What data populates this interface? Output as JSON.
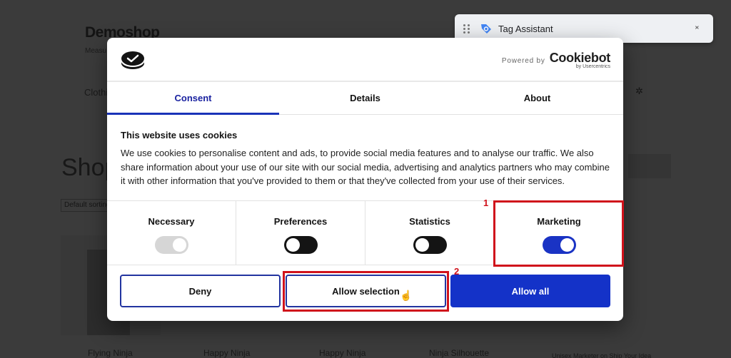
{
  "background_page": {
    "brand": "Demoshop",
    "tagline": "Measu",
    "nav_first": "Clothi",
    "page_title": "Shop",
    "sort_select": "Default sorting",
    "products": [
      "Flying Ninja",
      "Happy Ninja",
      "Happy Ninja",
      "Ninja Silhouette",
      "Unisex Marketer on Ship Your Idea"
    ]
  },
  "tag_assistant": {
    "title": "Tag Assistant",
    "brand_color": "#4285f4"
  },
  "dialog": {
    "powered_by": "Powered by",
    "provider_name": "Cookiebot",
    "provider_sub": "by Usercentrics",
    "tabs": [
      {
        "label": "Consent",
        "active": true
      },
      {
        "label": "Details",
        "active": false
      },
      {
        "label": "About",
        "active": false
      }
    ],
    "heading": "This website uses cookies",
    "body": "We use cookies to personalise content and ads, to provide social media features and to analyse our traffic. We also share information about your use of our site with our social media, advertising and analytics partners who may combine it with other information that you've provided to them or that they've collected from your use of their services.",
    "categories": [
      {
        "label": "Necessary",
        "state": "on",
        "disabled": true
      },
      {
        "label": "Preferences",
        "state": "off",
        "disabled": false
      },
      {
        "label": "Statistics",
        "state": "off",
        "disabled": false
      },
      {
        "label": "Marketing",
        "state": "on",
        "disabled": false
      }
    ],
    "buttons": {
      "deny": "Deny",
      "allow_selection": "Allow selection",
      "allow_all": "Allow all"
    },
    "accent_color": "#1432c8"
  },
  "annotations": [
    {
      "number": "1",
      "target": "Marketing toggle",
      "color": "#d0121b"
    },
    {
      "number": "2",
      "target": "Allow selection button",
      "color": "#d0121b"
    }
  ]
}
